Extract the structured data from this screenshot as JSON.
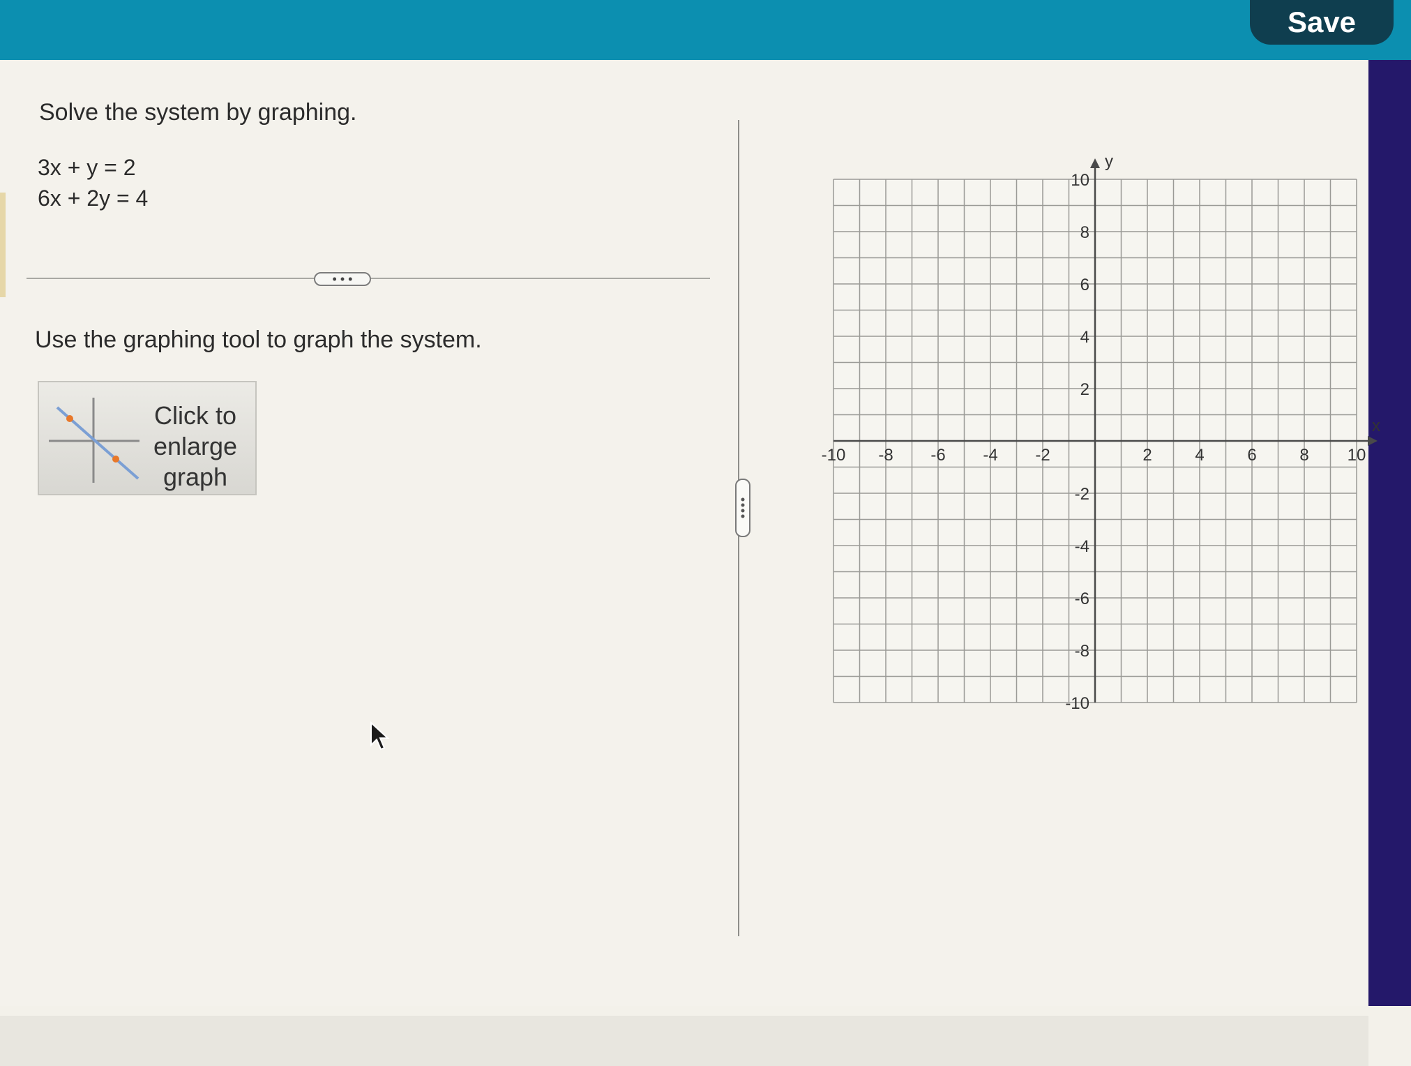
{
  "header": {
    "save_label": "Save"
  },
  "problem": {
    "instruction": "Solve the system by graphing.",
    "equations": [
      "3x + y = 2",
      "6x + 2y = 4"
    ],
    "more_label": "• • •",
    "tool_instruction": "Use the graphing tool to graph the system.",
    "enlarge_label": "Click to enlarge graph"
  },
  "graph": {
    "x_axis_label": "x",
    "y_axis_label": "y",
    "range": [
      -10,
      10
    ],
    "grid_step": 1,
    "label_step": 2,
    "x_tick_labels": [
      "-10",
      "-8",
      "-6",
      "-4",
      "-2",
      "2",
      "4",
      "6",
      "8",
      "10"
    ],
    "y_tick_labels": [
      "10",
      "8",
      "6",
      "4",
      "2",
      "-2",
      "-4",
      "-6",
      "-8",
      "-10"
    ],
    "grid_color": "#9a9a96",
    "axis_color": "#4a4a4a"
  },
  "colors": {
    "topbar": "#0c8fb0",
    "save_button": "#0f3e4f",
    "right_panel": "#24186a",
    "thumb_point": "#e8782a",
    "thumb_line": "#7b9fd4"
  }
}
